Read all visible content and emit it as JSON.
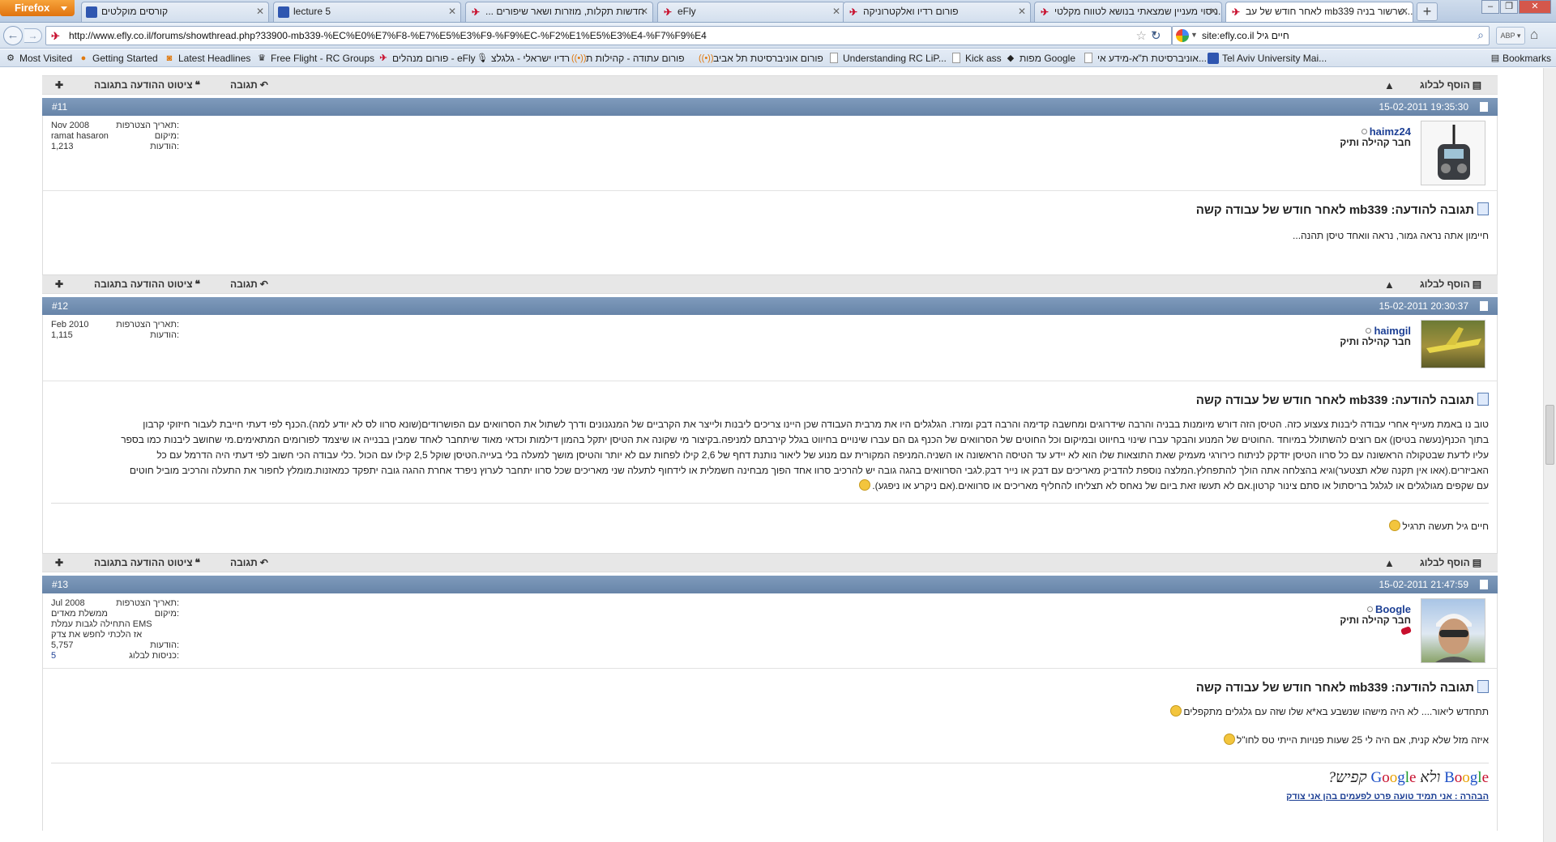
{
  "browser": {
    "menu_label": "Firefox",
    "tabs": [
      {
        "title": "קורסים מוקלטים",
        "icon": "blue"
      },
      {
        "title": "lecture 5",
        "icon": "blue"
      },
      {
        "title": "... חדשות תקלות, מוזרות ושאר שיפורים",
        "icon": "red"
      },
      {
        "title": "eFly",
        "icon": "red"
      },
      {
        "title": "פורום רדיו ואלקטרוניקה",
        "icon": "red"
      },
      {
        "title": "ניסוי מעניין שמצאתי בנושא לטווח מקלטי...",
        "icon": "red"
      },
      {
        "title": "לאחר חודש של עב mb339 שרשור בניה...",
        "icon": "red",
        "active": true
      }
    ],
    "url": "http://www.efly.co.il/forums/showthread.php?33900-mb339-%EC%E0%E7%F8-%E7%E5%E3%F9-%F9%EC-%F2%E1%E5%E3%E4-%F7%F9%E4",
    "search_query": "site:efly.co.il חיים גיל",
    "addon_label": "ABP",
    "bookmarks": [
      {
        "label": "Most Visited",
        "icon": "gear"
      },
      {
        "label": "Getting Started",
        "icon": "firefox"
      },
      {
        "label": "Latest Headlines",
        "icon": "rss"
      },
      {
        "label": "Free Flight - RC Groups",
        "icon": "rc"
      },
      {
        "label": "פורום מנהלים - eFly",
        "icon": "red"
      },
      {
        "label": "רדיו ישראלי - גלגלצ",
        "icon": "mic"
      },
      {
        "label": "פורום עתודה - קהילות ת",
        "icon": "orange"
      },
      {
        "label": "פורום אוניברסיטת תל אביב",
        "icon": "orange"
      },
      {
        "label": "Understanding RC LiP...",
        "icon": "page"
      },
      {
        "label": "Kick ass",
        "icon": "page"
      },
      {
        "label": "מפות Google",
        "icon": "google"
      },
      {
        "label": "אוניברסיטת ת\"א-מידע אי...",
        "icon": "page"
      },
      {
        "label": "Tel Aviv University Mai...",
        "icon": "blue"
      }
    ],
    "bookmarks_menu": "Bookmarks"
  },
  "actions": {
    "quote_reply": "ציטוט ההודעה בתגובה",
    "reply": "תגובה",
    "add_to_blog": "הוסף לבלוג"
  },
  "labels": {
    "join_date": "תאריך הצטרפות:",
    "location": "מיקום:",
    "posts": "הודעות:",
    "blog_entries": "כניסות לבלוג:"
  },
  "posts": [
    {
      "number": "#11",
      "date": "15-02-2011 19:35:30",
      "username": "haimz24",
      "user_title": "חבר קהילה ותיק",
      "join_date": "Nov 2008",
      "location": "ramat hasaron",
      "post_count": "1,213",
      "title": "תגובה להודעה: mb339 לאחר חודש של עבודה קשה",
      "body": "חיימון אתה נראה גמור, נראה וואחד טיסן תהנה..."
    },
    {
      "number": "#12",
      "date": "15-02-2011 20:30:37",
      "username": "haimgil",
      "user_title": "חבר קהילה ותיק",
      "join_date": "Feb 2010",
      "post_count": "1,115",
      "title": "תגובה להודעה: mb339 לאחר חודש של עבודה קשה",
      "body_lines": [
        "טוב נו באמת מעייף אחרי עבודה ליבנות צעצוע כזה. הטיסן הזה דורש מיומנות בבניה והרבה שידרוגים ומחשבה קדימה והרבה דבק ומזרז. הגלגלים היו את מרבית העבודה שכן היינו צריכים ליבנות ולייצר את הקרביים של המנגנונים ודרך לשתול את הסרוואים עם הפושרודים(שונא סרוו לס לא יודע למה).הכנף לפי דעתי חייבת לעבור חיזוקי קרבון",
        "בתוך הכנף(נעשה בטיסן) אם רוצים להשתולל במיוחד .החוטים של המנוע והבקר עברו שינוי בחיווט ובמיקום וכל החוטים של הסרוואים של הכנף גם הם עברו שינויים בחיווט בגלל קירבתם למניפה.בקיצור מי שקונה את הטיסן יתקל בהמון דילמות וכדאי מאוד שיתחבר לאחד שמבין בבנייה או שיצמד לפורומים המתאימים.מי שחושב ליבנות כמו בספר",
        "עליו לדעת שבטקולה הראשונה עם כל סרוו הטיסן יזדקק לניתוח כירורגי מעמיק שאת התוצאות שלו הוא לא יידע עד הטיסה הראשונה או השניה.המניפה המקורית עם מנוע של ליאור נותנת דחף של 2,6 קילו לפחות עם לא יותר והטיסן מושך למעלה בלי בעייה.הטיסן שוקל 2,5 קילו עם הכול .כלי עבודה הכי חשוב לפי דעתי היה הדרמל עם כל",
        "האביזרים.(אאו אין תקנה שלא תצטער)וגיא בהצלחה אתה הולך להתפחלץ.המלצה נוספת להדביק מאריכים עם דבק או נייר דבק.לגבי הסרוואים בהגה גובה יש להרכיב סרוו אחד הפוך מבחינה חשמלית או לידחוף לתעלה שני מאריכים שכל סרוו יתחבר לערוץ ניפרד אחרת ההגה גובה יתפקד כמאזנות.מומלץ לחפור את התעלה והרכיב מוביל חוטים",
        "עם שקפים מגולגלים או לגלגל בריסתול או סתם צינור קרטון.אם לא תעשו זאת ביום של נאחס לא תצליחו להחליף מאריכים או סרוואים.(אם ניקרע או ניפגע)."
      ],
      "signature": "חיים גיל תעשה תרגיל"
    },
    {
      "number": "#13",
      "date": "15-02-2011 21:47:59",
      "username": "Boogle",
      "user_title": "חבר קהילה ותיק",
      "join_date": "Jul 2008",
      "location": "ממשלת מאדים",
      "location_extra": [
        "התחילה לגבות עמלת EMS",
        "אז הלכתי לחפש את צדק"
      ],
      "post_count": "5,757",
      "blog_entries": "5",
      "title": "תגובה להודעה: mb339 לאחר חודש של עבודה קשה",
      "body_lines": [
        "תתחדש ליאור.... לא היה מישהו שנשבע בא*א שלו שזה עם גלגלים מתקפלים",
        "איזה מזל שלא קנית, אם היה לי 25 שעות פנויות הייתי טס לחו\"ל"
      ],
      "sig_logo": {
        "first": "Boogle",
        "and": "ולא",
        "second": "Google",
        "rest": "קפיש?"
      },
      "sig_link": "הבהרה : אני תמיד טועה פרט לפעמים בהן אני צודק"
    }
  ]
}
